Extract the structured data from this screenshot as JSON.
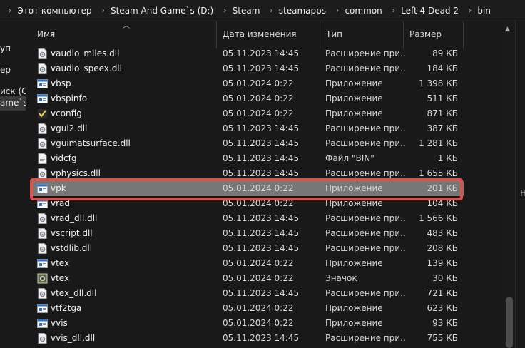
{
  "breadcrumb": [
    "Этот компьютер",
    "Steam And Game`s (D:)",
    "Steam",
    "steamapps",
    "common",
    "Left 4 Dead 2",
    "bin"
  ],
  "nav": [
    {
      "label": "уп"
    },
    {
      "label": "ер"
    },
    {
      "label": "иск (C"
    },
    {
      "label": "ame`s",
      "selected": true
    }
  ],
  "columns": {
    "name": "Имя",
    "date": "Дата изменения",
    "type": "Тип",
    "size": "Размер"
  },
  "files": [
    {
      "name": "vaudio_miles.dll",
      "date": "05.11.2023 14:45",
      "type": "Расширение при...",
      "size": "89 КБ",
      "icon": "dll"
    },
    {
      "name": "vaudio_speex.dll",
      "date": "05.11.2023 14:45",
      "type": "Расширение при...",
      "size": "184 КБ",
      "icon": "dll"
    },
    {
      "name": "vbsp",
      "date": "05.01.2024 0:22",
      "type": "Приложение",
      "size": "1 398 КБ",
      "icon": "exe"
    },
    {
      "name": "vbspinfo",
      "date": "05.01.2024 0:22",
      "type": "Приложение",
      "size": "511 КБ",
      "icon": "exe"
    },
    {
      "name": "vconfig",
      "date": "05.01.2024 0:22",
      "type": "Приложение",
      "size": "871 КБ",
      "icon": "check"
    },
    {
      "name": "vgui2.dll",
      "date": "05.11.2023 14:45",
      "type": "Расширение при...",
      "size": "387 КБ",
      "icon": "dll"
    },
    {
      "name": "vguimatsurface.dll",
      "date": "05.11.2023 14:45",
      "type": "Расширение при...",
      "size": "1 281 КБ",
      "icon": "dll"
    },
    {
      "name": "vidcfg",
      "date": "05.11.2023 14:45",
      "type": "Файл \"BIN\"",
      "size": "1 КБ",
      "icon": "file"
    },
    {
      "name": "vphysics.dll",
      "date": "05.11.2023 14:45",
      "type": "Расширение при...",
      "size": "1 655 КБ",
      "icon": "dll"
    },
    {
      "name": "vpk",
      "date": "05.01.2024 0:22",
      "type": "Приложение",
      "size": "201 КБ",
      "icon": "exe",
      "highlight": true
    },
    {
      "name": "vrad",
      "date": "05.01.2024 0:22",
      "type": "Приложение",
      "size": "104 КБ",
      "icon": "exe"
    },
    {
      "name": "vrad_dll.dll",
      "date": "05.11.2023 14:45",
      "type": "Расширение при...",
      "size": "1 566 КБ",
      "icon": "dll"
    },
    {
      "name": "vscript.dll",
      "date": "05.11.2023 14:45",
      "type": "Расширение при...",
      "size": "483 КБ",
      "icon": "dll"
    },
    {
      "name": "vstdlib.dll",
      "date": "05.11.2023 14:45",
      "type": "Расширение при...",
      "size": "208 КБ",
      "icon": "dll"
    },
    {
      "name": "vtex",
      "date": "05.01.2024 0:22",
      "type": "Приложение",
      "size": "139 КБ",
      "icon": "exe"
    },
    {
      "name": "vtex",
      "date": "05.01.2024 0:22",
      "type": "Значок",
      "size": "30 КБ",
      "icon": "ico"
    },
    {
      "name": "vtex_dll.dll",
      "date": "05.11.2023 14:45",
      "type": "Расширение при...",
      "size": "721 КБ",
      "icon": "dll"
    },
    {
      "name": "vtf2tga",
      "date": "05.01.2024 0:22",
      "type": "Приложение",
      "size": "623 КБ",
      "icon": "exe"
    },
    {
      "name": "vvis",
      "date": "05.01.2024 0:22",
      "type": "Приложение",
      "size": "93 КБ",
      "icon": "exe"
    },
    {
      "name": "vvis_dll.dll",
      "date": "05.11.2023 14:45",
      "type": "Расширение при...",
      "size": "755 КБ",
      "icon": "dll"
    }
  ],
  "preview_char": "Н",
  "colors": {
    "highlight_row": "#777777",
    "highlight_frame": "#d9534f",
    "exe_icon": "#2f6fc4"
  }
}
